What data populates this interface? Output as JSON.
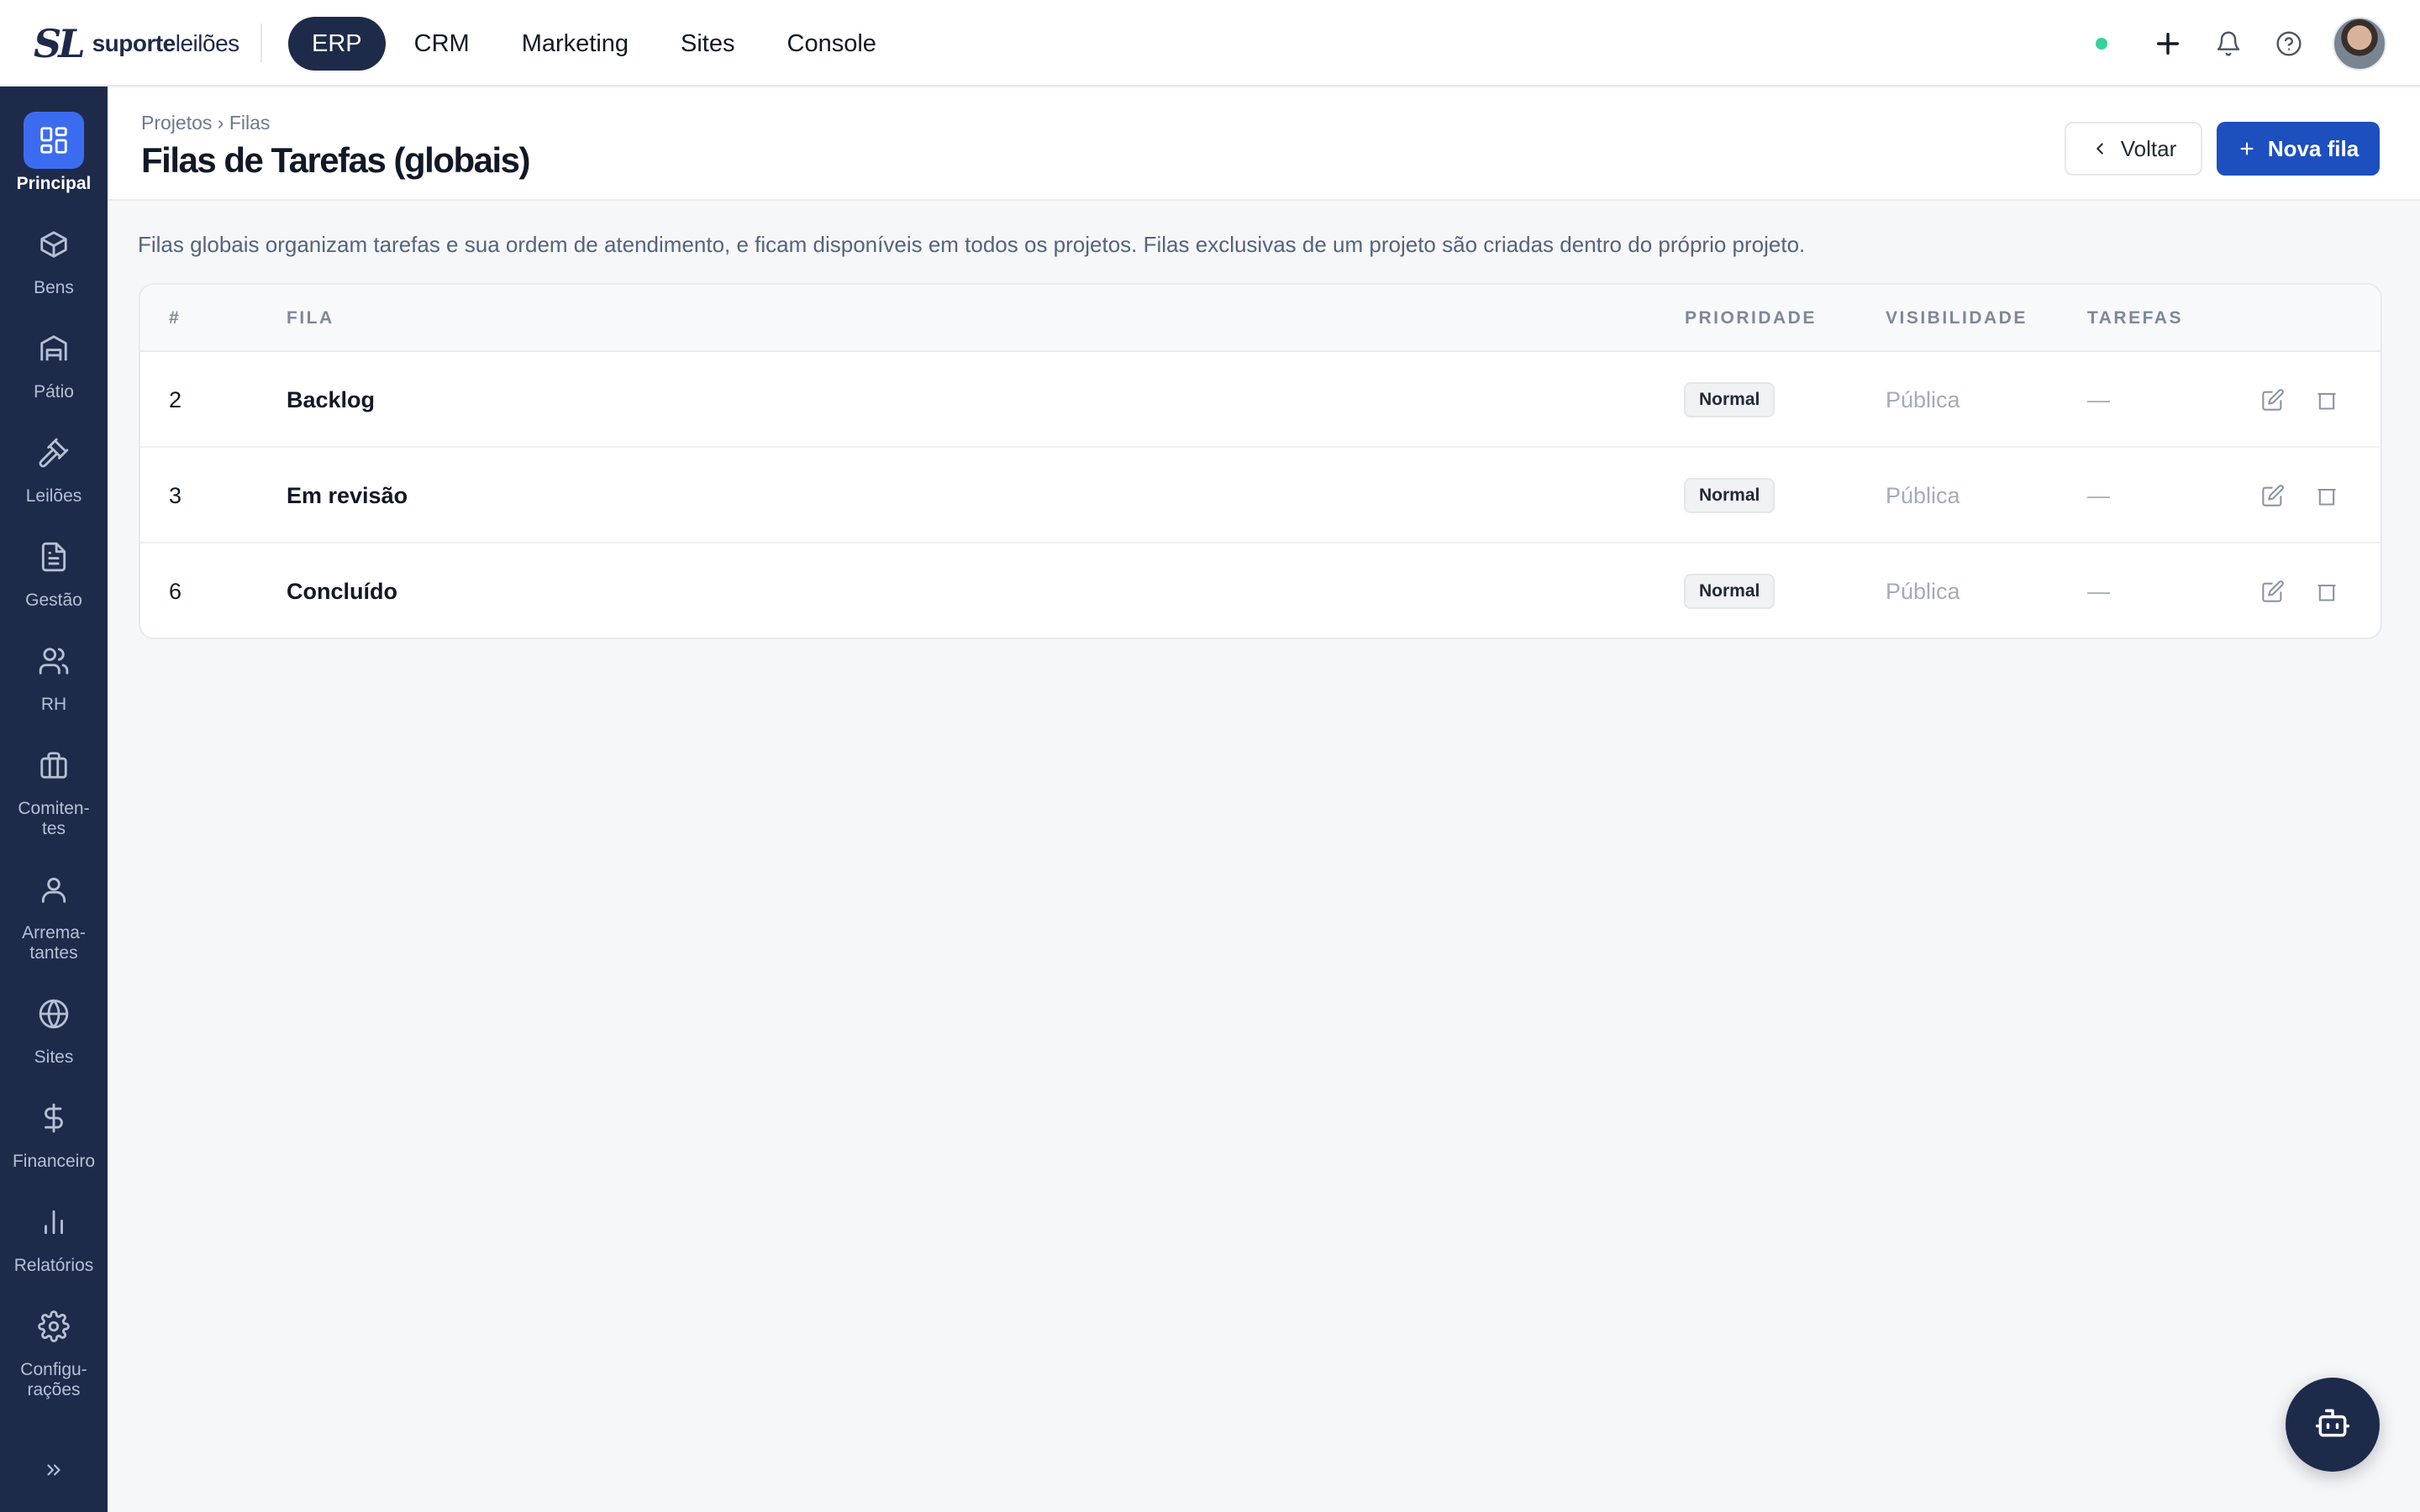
{
  "brand": {
    "logo_mark": "SL",
    "name_bold": "suporte",
    "name_light": "leilões"
  },
  "topnav": [
    {
      "label": "ERP",
      "active": true
    },
    {
      "label": "CRM",
      "active": false
    },
    {
      "label": "Marketing",
      "active": false
    },
    {
      "label": "Sites",
      "active": false
    },
    {
      "label": "Console",
      "active": false
    }
  ],
  "topbar": {
    "status_color": "#34d399",
    "icons": [
      "plus-icon",
      "bell-icon",
      "help-icon"
    ]
  },
  "sidebar": {
    "items": [
      {
        "label": "Principal",
        "icon": "grid-icon",
        "active": true
      },
      {
        "label": "Bens",
        "icon": "box-icon"
      },
      {
        "label": "Pátio",
        "icon": "warehouse-icon"
      },
      {
        "label": "Leilões",
        "icon": "gavel-icon"
      },
      {
        "label": "Gestão",
        "icon": "document-icon"
      },
      {
        "label": "RH",
        "icon": "users-icon"
      },
      {
        "label": "Comiten-\ntes",
        "icon": "briefcase-icon"
      },
      {
        "label": "Arrema-\ntantes",
        "icon": "user-icon"
      },
      {
        "label": "Sites",
        "icon": "globe-icon"
      },
      {
        "label": "Financeiro",
        "icon": "dollar-icon"
      },
      {
        "label": "Relatórios",
        "icon": "bar-chart-icon"
      },
      {
        "label": "Configu-\nrações",
        "icon": "gear-icon"
      }
    ],
    "collapse_icon": "chevrons-right-icon"
  },
  "page": {
    "breadcrumb": [
      "Projetos",
      "›",
      "Filas"
    ],
    "title": "Filas de Tarefas (globais)",
    "back_label": "Voltar",
    "new_label": "Nova fila",
    "description": "Filas globais organizam tarefas e sua ordem de atendimento, e ficam disponíveis em todos os projetos. Filas exclusivas de um projeto são criadas dentro do próprio projeto."
  },
  "table": {
    "columns": {
      "num": "#",
      "name": "FILA",
      "priority": "PRIORIDADE",
      "visibility": "VISIBILIDADE",
      "tasks": "TAREFAS"
    },
    "rows": [
      {
        "num": "2",
        "name": "Backlog",
        "priority": "Normal",
        "visibility": "Pública",
        "tasks": "—"
      },
      {
        "num": "3",
        "name": "Em revisão",
        "priority": "Normal",
        "visibility": "Pública",
        "tasks": "—"
      },
      {
        "num": "6",
        "name": "Concluído",
        "priority": "Normal",
        "visibility": "Pública",
        "tasks": "—"
      }
    ]
  },
  "colors": {
    "navy": "#1e2a4a",
    "accent": "#1d4fbf",
    "active_side": "#3b6cf0"
  }
}
